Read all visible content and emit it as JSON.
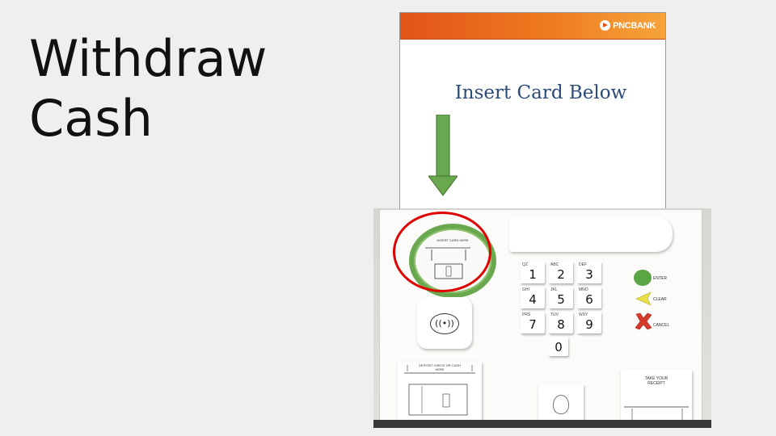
{
  "slide": {
    "title_line1": "Withdraw",
    "title_line2": "Cash"
  },
  "atm_screen": {
    "bank_name": "PNCBANK",
    "prompt": "Insert Card Below",
    "header_gradient": [
      "#e2531a",
      "#f6a43a"
    ],
    "prompt_color": "#2c4a76",
    "arrow_color": "#6aa84f"
  },
  "atm_panel": {
    "card_slot_label": "INSERT CARD HERE",
    "highlight_color": "#e00000",
    "contactless_icon": "contactless-icon",
    "keys": [
      {
        "num": "1",
        "sub": "QZ"
      },
      {
        "num": "2",
        "sub": "ABC"
      },
      {
        "num": "3",
        "sub": "DEF"
      },
      {
        "num": "4",
        "sub": "GHI"
      },
      {
        "num": "5",
        "sub": "JKL"
      },
      {
        "num": "6",
        "sub": "MNO"
      },
      {
        "num": "7",
        "sub": "PRS"
      },
      {
        "num": "8",
        "sub": "TUV"
      },
      {
        "num": "9",
        "sub": "WXY"
      },
      {
        "num": "0",
        "sub": ""
      }
    ],
    "enter_label": "ENTER",
    "clear_label": "CLEAR",
    "cancel_label": "CANCEL",
    "deposit_label": "DEPOSIT CHECK OR CASH HERE",
    "cash_label": "TAKE YOUR RECEIPT",
    "button_colors": {
      "enter": "#5aa645",
      "clear": "#e8e04a",
      "cancel": "#d63b2a"
    }
  }
}
